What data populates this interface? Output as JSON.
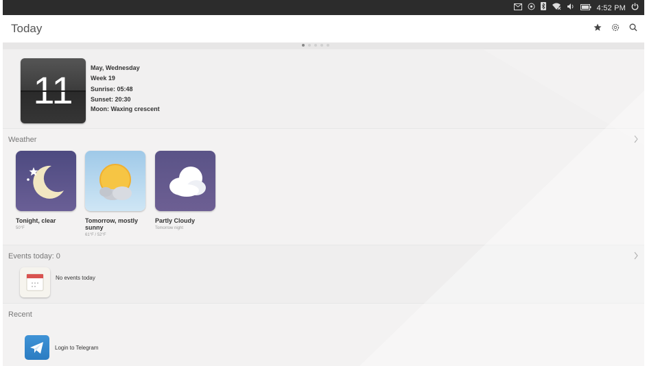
{
  "statusbar": {
    "time": "4:52 PM",
    "icons": [
      "mail-icon",
      "location-icon",
      "bluetooth-icon",
      "network-icon",
      "volume-icon",
      "battery-icon",
      "power-icon"
    ]
  },
  "header": {
    "title": "Today",
    "actions": [
      "star-icon",
      "settings-icon",
      "search-icon"
    ]
  },
  "pager": {
    "pages": 5,
    "active": 0
  },
  "date": {
    "day": "11",
    "line1": "May, Wednesday",
    "line2": "Week 19",
    "sunrise": "Sunrise: 05:48",
    "sunset": "Sunset: 20:30",
    "moon": "Moon: Waxing crescent"
  },
  "weather": {
    "title": "Weather",
    "items": [
      {
        "label": "Tonight, clear",
        "sub": "50°F",
        "icon": "moon-icon"
      },
      {
        "label": "Tomorrow, mostly sunny",
        "sub": "61°F / 52°F",
        "icon": "sun-cloud-icon"
      },
      {
        "label": "Partly Cloudy",
        "sub": "Tomorrow night",
        "icon": "cloud-icon"
      }
    ]
  },
  "events": {
    "title": "Events today: 0",
    "empty": "No events today"
  },
  "recent": {
    "title": "Recent",
    "item": "Login to Telegram"
  },
  "colors": {
    "statusbar": "#2c2c2c",
    "background": "#f4f3f3",
    "night_tile": "#5a5387",
    "day_tile": "#9fc9e8",
    "telegram": "#2b7cc2"
  }
}
